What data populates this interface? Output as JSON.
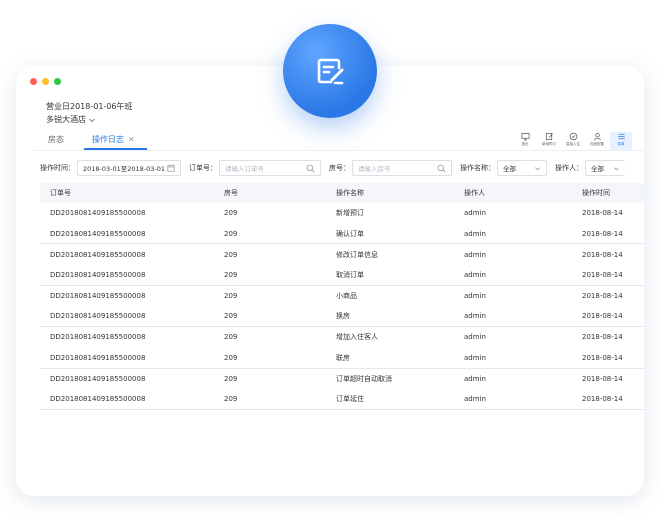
{
  "window": {
    "dots": [
      "#ff5f57",
      "#ffbd2e",
      "#28c840"
    ]
  },
  "header": {
    "business_day": "营业日2018-01-06午班",
    "hotel": "多锐大酒店"
  },
  "tabs": [
    {
      "label": "房态"
    },
    {
      "label": "操作日志"
    }
  ],
  "toolbar": [
    {
      "label": "退出",
      "icon": "monitor-icon"
    },
    {
      "label": "新增预订",
      "icon": "edit-icon"
    },
    {
      "label": "直接入住",
      "icon": "check-circle-icon"
    },
    {
      "label": "页面配置",
      "icon": "user-icon"
    },
    {
      "label": "菜单",
      "icon": "menu-icon"
    }
  ],
  "filters": {
    "op_time_label": "操作时间：",
    "op_time_value": "2018-03-01至2018-03-01",
    "order_label": "订单号：",
    "order_placeholder": "请输入订单号",
    "room_label": "房号：",
    "room_placeholder": "请输入房号",
    "op_name_label": "操作名称：",
    "op_name_value": "全部",
    "operator_label": "操作人：",
    "operator_value": "全部"
  },
  "table": {
    "headers": [
      "订单号",
      "房号",
      "操作名称",
      "操作人",
      "操作时间"
    ],
    "rows": [
      {
        "order": "DD2018081409185500008",
        "room": "209",
        "op": "新增预订",
        "user": "admin",
        "time": "2018-08-14"
      },
      {
        "order": "DD2018081409185500008",
        "room": "209",
        "op": "确认订单",
        "user": "admin",
        "time": "2018-08-14"
      },
      {
        "order": "DD2018081409185500008",
        "room": "209",
        "op": "修改订单信息",
        "user": "admin",
        "time": "2018-08-14"
      },
      {
        "order": "DD2018081409185500008",
        "room": "209",
        "op": "取消订单",
        "user": "admin",
        "time": "2018-08-14"
      },
      {
        "order": "DD2018081409185500008",
        "room": "209",
        "op": "小商品",
        "user": "admin",
        "time": "2018-08-14"
      },
      {
        "order": "DD2018081409185500008",
        "room": "209",
        "op": "换房",
        "user": "admin",
        "time": "2018-08-14"
      },
      {
        "order": "DD2018081409185500008",
        "room": "209",
        "op": "增加入住客人",
        "user": "admin",
        "time": "2018-08-14"
      },
      {
        "order": "DD2018081409185500008",
        "room": "209",
        "op": "联房",
        "user": "admin",
        "time": "2018-08-14"
      },
      {
        "order": "DD2018081409185500008",
        "room": "209",
        "op": "订单超时自动取消",
        "user": "admin",
        "time": "2018-08-14"
      },
      {
        "order": "DD2018081409185500008",
        "room": "209",
        "op": "订单延住",
        "user": "admin",
        "time": "2018-08-14"
      }
    ]
  }
}
